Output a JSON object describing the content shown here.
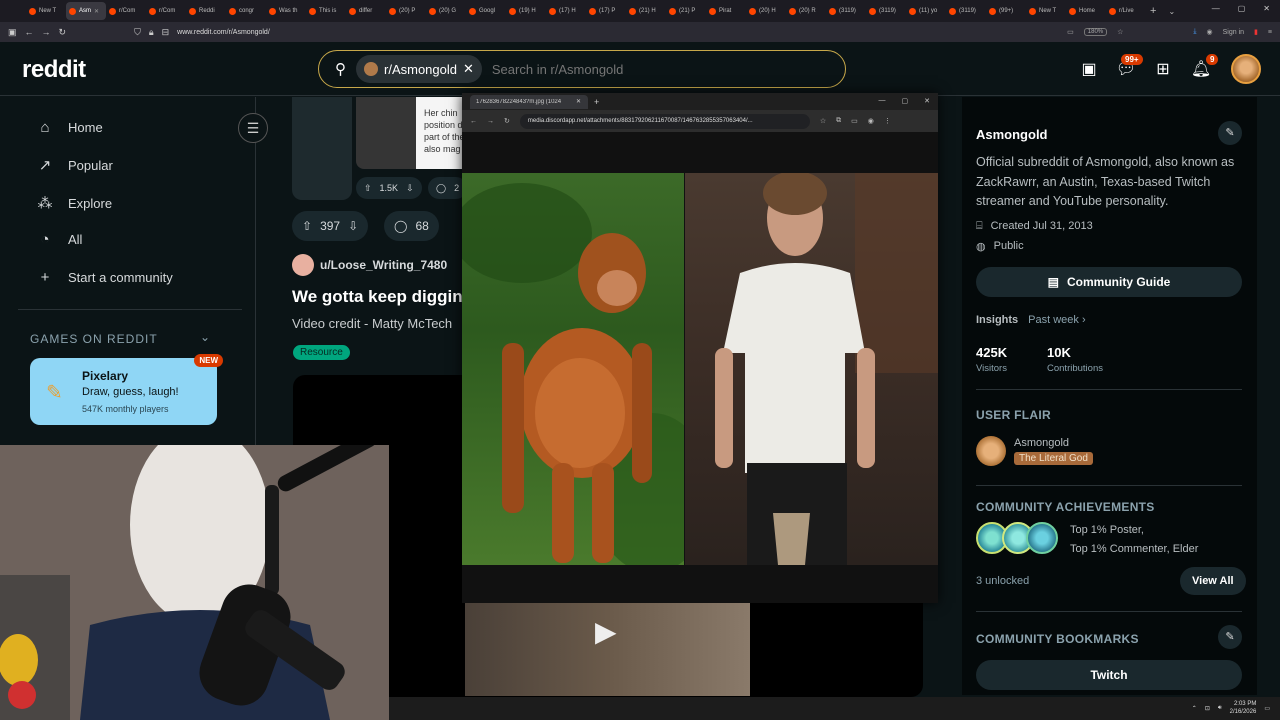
{
  "browser": {
    "tabs": [
      "New T",
      "Asm",
      "r/Com",
      "r/Com",
      "Reddi",
      "congr",
      "Was th",
      "This is",
      "differ",
      "(20) P",
      "(20) G",
      "Googl",
      "(19) H",
      "(17) H",
      "(17) P",
      "(21) H",
      "(21) P",
      "Pirat",
      "(20) H",
      "(20) R",
      "(3119)",
      "(3119)",
      "(11) yo",
      "(3119)",
      "(99+)",
      "New T",
      "Home",
      "r/Live"
    ],
    "active_tab_index": 1,
    "url": "www.reddit.com/r/Asmongold/",
    "zoom": "180%",
    "sign_in": "Sign in"
  },
  "header": {
    "logo": "reddit",
    "search_chip": "r/Asmongold",
    "search_placeholder": "Search in r/Asmongold",
    "chat_badge": "99+",
    "notif_badge": "9"
  },
  "leftnav": {
    "items": [
      {
        "label": "Home",
        "icon": "home-icon"
      },
      {
        "label": "Popular",
        "icon": "popular-icon"
      },
      {
        "label": "Explore",
        "icon": "explore-icon"
      },
      {
        "label": "All",
        "icon": "all-icon"
      },
      {
        "label": "Start a community",
        "icon": "plus-icon"
      }
    ],
    "games_label": "GAMES ON REDDIT",
    "game": {
      "title": "Pixelary",
      "subtitle": "Draw, guess, laugh!",
      "players": "547K monthly players",
      "badge": "NEW"
    }
  },
  "feed": {
    "prev_card_text": "Her chin position d part of the also mag",
    "prev_votes": "1.5K",
    "prev_comments": "2",
    "votes": "397",
    "comments": "68",
    "post": {
      "user": "u/Loose_Writing_7480",
      "title": "We gotta keep digging",
      "body": "Video credit - Matty McTech",
      "flair": "Resource"
    }
  },
  "popup": {
    "tab_title": "176283678224843?m.jpg (1024",
    "url": "media.discordapp.net/attachments/883179206211670087/1467632855357063404/..."
  },
  "sidebar": {
    "name": "Asmongold",
    "description": "Official subreddit of Asmongold, also known as ZackRawrr, an Austin, Texas-based Twitch streamer and YouTube personality.",
    "created": "Created Jul 31, 2013",
    "visibility": "Public",
    "guide_button": "Community Guide",
    "insights_label": "Insights",
    "insights_range": "Past week",
    "visitors_value": "425K",
    "visitors_label": "Visitors",
    "contrib_value": "10K",
    "contrib_label": "Contributions",
    "flair_section": "USER FLAIR",
    "flair_user": "Asmongold",
    "flair_tag": "The Literal God",
    "achievements_section": "COMMUNITY ACHIEVEMENTS",
    "achievement_1": "Top 1% Poster,",
    "achievement_2": "Top 1% Commenter, Elder",
    "unlocked": "3 unlocked",
    "view_all": "View All",
    "bookmarks_section": "COMMUNITY BOOKMARKS",
    "bookmark_1": "Twitch"
  },
  "taskbar": {
    "time": "2:03 PM",
    "date": "2/16/2026"
  },
  "colors": {
    "background": "#0b1416",
    "accent": "#d93a00",
    "flair_green": "#00a67e",
    "search_border": "#c7a84a"
  }
}
